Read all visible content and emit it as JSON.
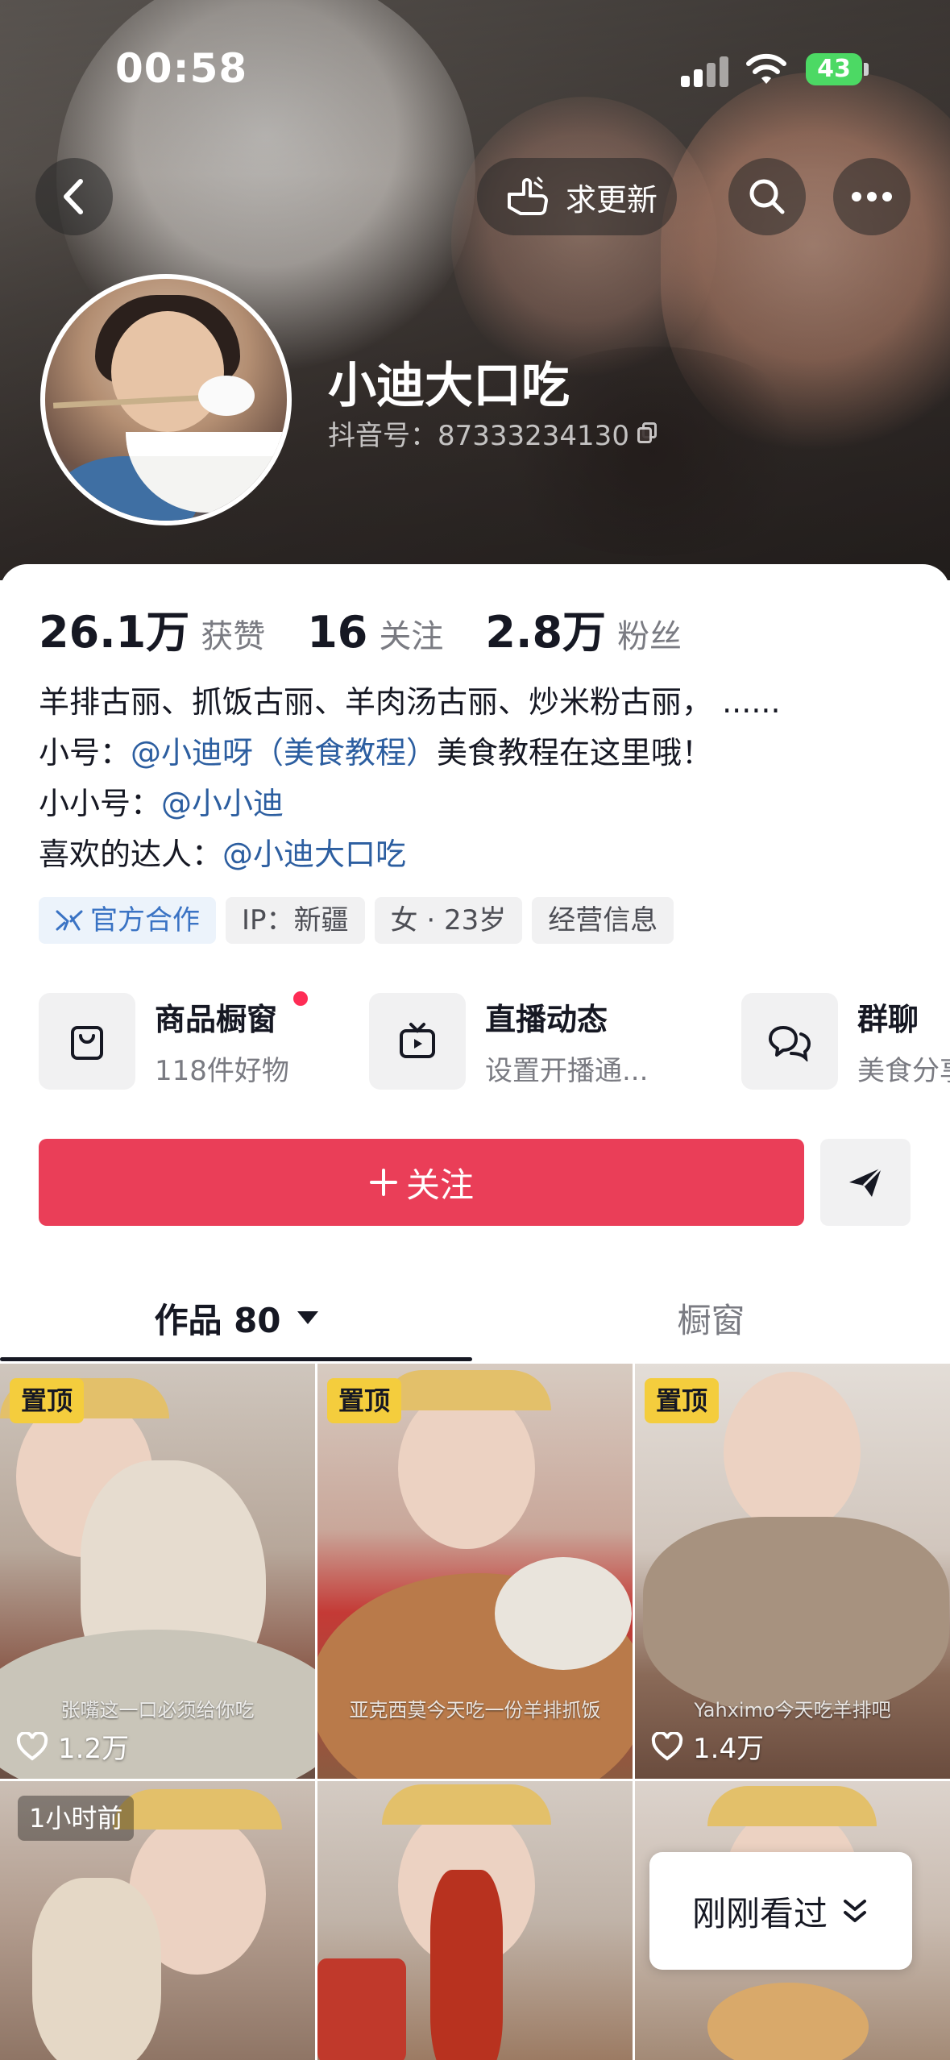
{
  "status_bar": {
    "time": "00:58",
    "battery": "43"
  },
  "header": {
    "update_request_label": "求更新",
    "nickname": "小迪大口吃",
    "douyin_id": "抖音号：87333234130"
  },
  "stats": {
    "likes_value": "26.1万",
    "likes_label": "获赞",
    "following_value": "16",
    "following_label": "关注",
    "followers_value": "2.8万",
    "followers_label": "粉丝"
  },
  "bio": {
    "line1": "羊排古丽、抓饭古丽、羊肉汤古丽、炒米粉古丽，  ......",
    "line2_prefix": "小号：",
    "line2_mention": "@小迪呀（美食教程）",
    "line2_suffix": "美食教程在这里哦！",
    "line3_prefix": "小小号：",
    "line3_mention": "@小小迪",
    "line4_prefix": "喜欢的达人：",
    "line4_mention": "@小迪大口吃"
  },
  "tags": [
    "官方合作",
    "IP：新疆",
    "女 · 23岁",
    "经营信息"
  ],
  "shortcuts": [
    {
      "title": "商品橱窗",
      "sub": "118件好物",
      "icon": "shopping-bag-icon"
    },
    {
      "title": "直播动态",
      "sub": "设置开播通...",
      "icon": "tv-icon"
    },
    {
      "title": "群聊",
      "sub": "美食分享",
      "icon": "chat-bubbles-icon"
    }
  ],
  "follow_label": "关注",
  "tabs": {
    "works_label": "作品 80",
    "shop_label": "橱窗"
  },
  "videos": [
    {
      "badge": "置顶",
      "likes": "1.2万",
      "caption": "张嘴这一口必须给你吃"
    },
    {
      "badge": "置顶",
      "likes": "",
      "caption": "亚克西莫今天吃一份羊排抓饭"
    },
    {
      "badge": "置顶",
      "likes": "1.4万",
      "caption": "Yahximo今天吃羊排吧"
    },
    {
      "badge": "1小时前",
      "likes": "",
      "caption": ""
    },
    {
      "badge": "",
      "likes": "",
      "caption": ""
    },
    {
      "badge": "",
      "likes": "",
      "caption": ""
    }
  ],
  "recent_label": "刚刚看过",
  "colors": {
    "follow_red": "#ea3e58",
    "mention_blue": "#2c5ea0",
    "pin_yellow": "#f4cd3d",
    "official_blue": "#3a73c4"
  }
}
